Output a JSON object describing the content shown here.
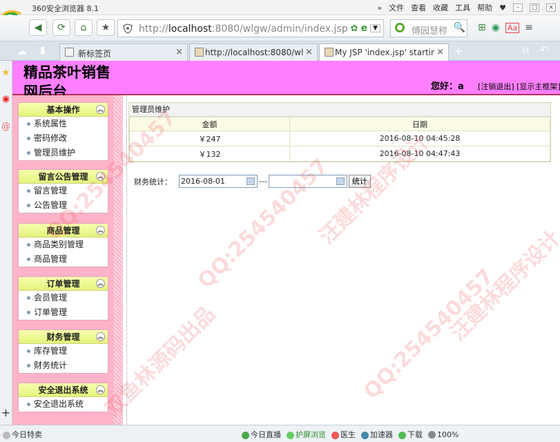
{
  "browser": {
    "app_title": "360安全浏览器 8.1",
    "menus": [
      "文件",
      "查看",
      "收藏",
      "工具",
      "帮助"
    ],
    "address": {
      "url_host": "localhost",
      "url_prefix": "http://",
      "url_suffix": ":8080/wlgw/admin/index.jsp"
    },
    "search_placeholder": "傅园慧称",
    "tabs": [
      {
        "label": "新标签页",
        "active": false
      },
      {
        "label": "http://localhost:8080/wlgw/i",
        "active": false
      },
      {
        "label": "My JSP 'index.jsp' starting p",
        "active": true
      }
    ]
  },
  "header": {
    "title": "精品茶叶销售网后台",
    "greeting": "您好：a",
    "logout_link": "[注销退出]",
    "toggle_frame_link": "[显示主框架]"
  },
  "sidebar": {
    "groups": [
      {
        "title": "基本操作",
        "items": [
          "系统属性",
          "密码修改",
          "管理员维护"
        ]
      },
      {
        "title": "留言公告管理",
        "items": [
          "留言管理",
          "公告管理"
        ]
      },
      {
        "title": "商品管理",
        "items": [
          "商品类别管理",
          "商品管理"
        ]
      },
      {
        "title": "订单管理",
        "items": [
          "会员管理",
          "订单管理"
        ]
      },
      {
        "title": "财务管理",
        "items": [
          "库存管理",
          "财务统计"
        ]
      },
      {
        "title": "安全退出系统",
        "items": [
          "安全退出系统"
        ]
      }
    ]
  },
  "main": {
    "panel_title": "管理员维护",
    "columns": [
      "金额",
      "日期"
    ],
    "rows": [
      [
        "￥247",
        "2016-08-10 04:45:28"
      ],
      [
        "￥132",
        "2016-08-10 04:47:43"
      ]
    ],
    "stats_label": "财务统计：",
    "start_date": "2016-08-01",
    "end_date": "",
    "separator": "---",
    "stats_button": "统计"
  },
  "statusbar": {
    "left": "今日特卖",
    "items": [
      "今日直播",
      "护屏浏览",
      "医生",
      "加速器",
      "下载",
      "100%"
    ]
  },
  "watermarks": [
    "QQ:254540457",
    "双鱼林源码出品",
    "汪建林程序设计"
  ]
}
